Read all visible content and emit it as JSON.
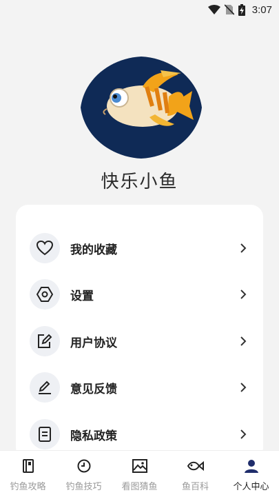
{
  "status_bar": {
    "time": "3:07",
    "icons": [
      "wifi-icon",
      "no-sim-icon",
      "battery-charging-icon"
    ]
  },
  "profile": {
    "nickname": "快乐小鱼",
    "avatar_icon": "fish-avatar-icon"
  },
  "menu": {
    "items": [
      {
        "label": "我的收藏",
        "icon": "heart-icon"
      },
      {
        "label": "设置",
        "icon": "hexagon-settings-icon"
      },
      {
        "label": "用户协议",
        "icon": "edit-document-icon"
      },
      {
        "label": "意见反馈",
        "icon": "pen-icon"
      },
      {
        "label": "隐私政策",
        "icon": "policy-document-icon"
      }
    ]
  },
  "bottom_nav": {
    "items": [
      {
        "label": "钓鱼攻略",
        "icon": "book-icon",
        "active": false
      },
      {
        "label": "钓鱼技巧",
        "icon": "clock-icon",
        "active": false
      },
      {
        "label": "看图猜鱼",
        "icon": "image-icon",
        "active": false
      },
      {
        "label": "鱼百科",
        "icon": "fish-icon",
        "active": false
      },
      {
        "label": "个人中心",
        "icon": "person-icon",
        "active": true
      }
    ]
  },
  "colors": {
    "accent": "#1f2d6b",
    "avatar_bg": "#0f2a56",
    "fish_orange": "#f2a319"
  }
}
